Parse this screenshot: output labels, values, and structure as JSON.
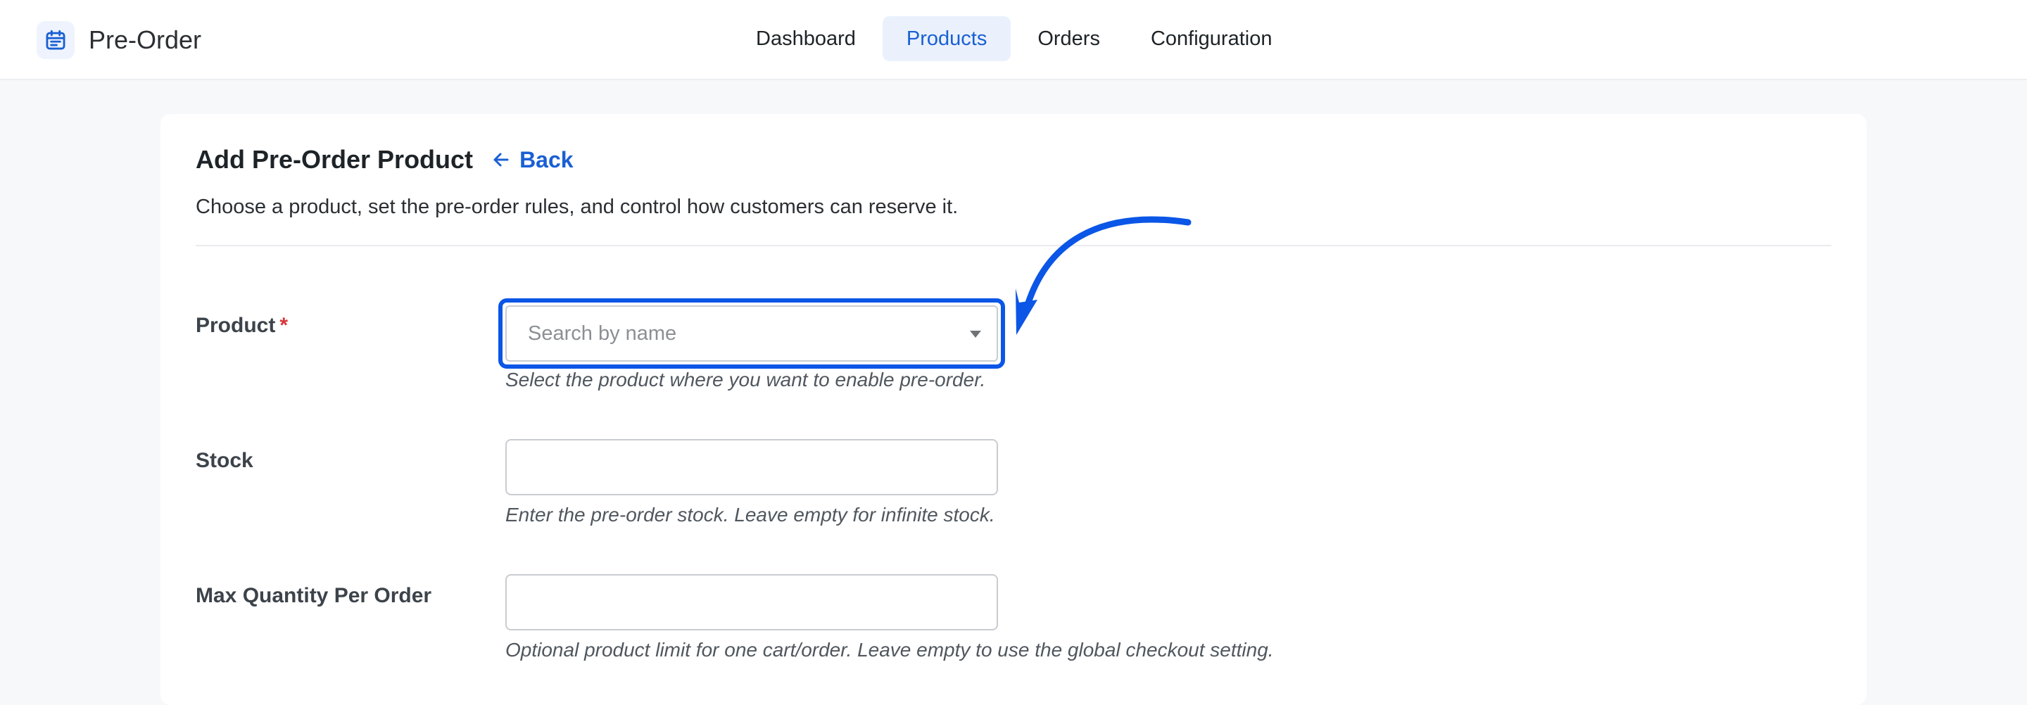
{
  "app": {
    "name": "Pre-Order",
    "icon": "calendar-icon"
  },
  "nav": {
    "tabs": [
      {
        "label": "Dashboard",
        "active": false
      },
      {
        "label": "Products",
        "active": true
      },
      {
        "label": "Orders",
        "active": false
      },
      {
        "label": "Configuration",
        "active": false
      }
    ]
  },
  "page": {
    "title": "Add Pre-Order Product",
    "back_label": "Back",
    "subtitle": "Choose a product, set the pre-order rules, and control how customers can reserve it."
  },
  "form": {
    "product": {
      "label": "Product",
      "required_mark": "*",
      "placeholder": "Search by name",
      "help": "Select the product where you want to enable pre-order."
    },
    "stock": {
      "label": "Stock",
      "value": "",
      "help": "Enter the pre-order stock. Leave empty for infinite stock."
    },
    "max_qty": {
      "label": "Max Quantity Per Order",
      "value": "",
      "help": "Optional product limit for one cart/order. Leave empty to use the global checkout setting."
    }
  },
  "colors": {
    "accent": "#1a5fd4",
    "highlight": "#0b56e6",
    "required": "#d63638"
  }
}
